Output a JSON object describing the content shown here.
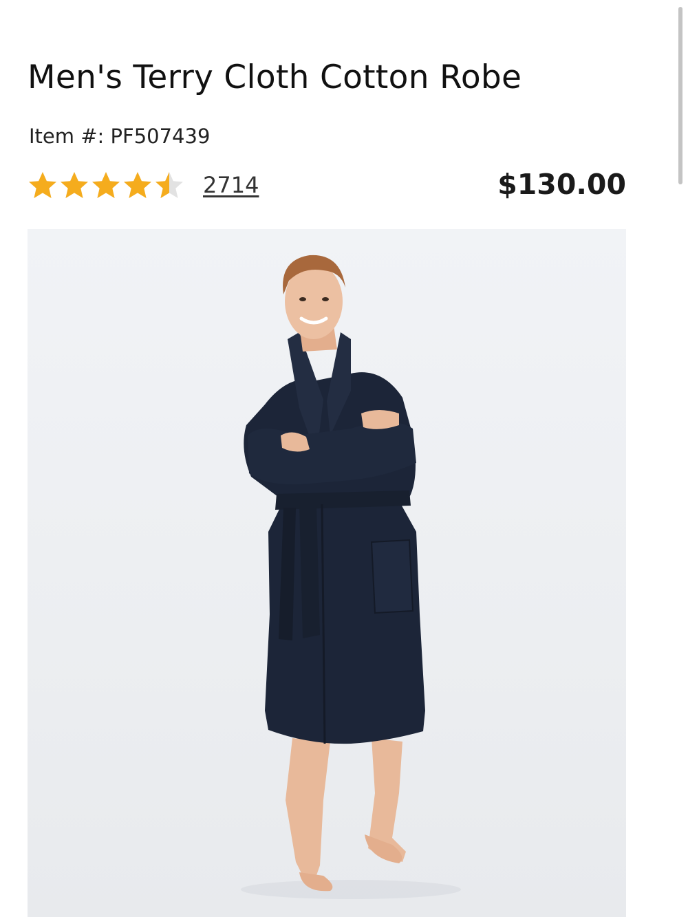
{
  "product": {
    "title": "Men's Terry Cloth Cotton Robe",
    "item_label": "Item #: PF507439",
    "rating": 4.5,
    "rating_max": 5,
    "review_count": "2714",
    "price": "$130.00"
  },
  "colors": {
    "star_filled": "#f5ac1d",
    "star_empty": "#e2e2e2",
    "robe": "#1c2538"
  },
  "icons": [
    "star-icon"
  ]
}
